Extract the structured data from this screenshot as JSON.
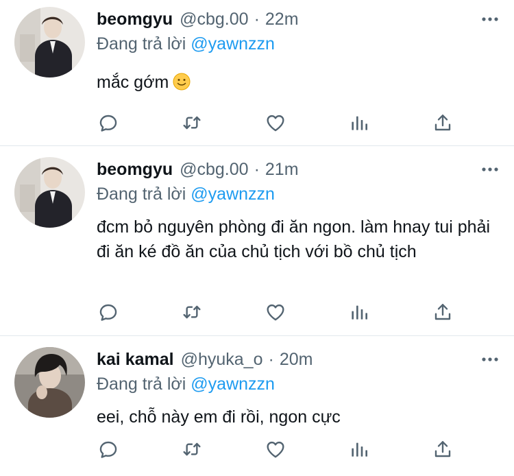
{
  "colors": {
    "text": "#0f1419",
    "secondary": "#536471",
    "mention": "#1d9bf0",
    "divider": "#e1e8ed"
  },
  "tweets": [
    {
      "name": "beomgyu",
      "handle": "@cbg.00",
      "separator": "·",
      "time": "22m",
      "replying_prefix": "Đang trả lời",
      "replying_to": "@yawnzzn",
      "text": "mắc gớm",
      "emoji": "slightly-smiling-face"
    },
    {
      "name": "beomgyu",
      "handle": "@cbg.00",
      "separator": "·",
      "time": "21m",
      "replying_prefix": "Đang trả lời",
      "replying_to": "@yawnzzn",
      "text": "đcm bỏ nguyên phòng đi ăn ngon. làm hnay tui phải đi ăn ké đồ ăn của chủ tịch với bồ chủ tịch"
    },
    {
      "name": "kai kamal",
      "handle": "@hyuka_o",
      "separator": "·",
      "time": "20m",
      "replying_prefix": "Đang trả lời",
      "replying_to": "@yawnzzn",
      "text": "eei, chỗ này em đi rồi, ngon cực"
    }
  ],
  "icons": [
    "reply-icon",
    "retweet-icon",
    "like-icon",
    "stats-icon",
    "share-icon",
    "more-icon"
  ]
}
